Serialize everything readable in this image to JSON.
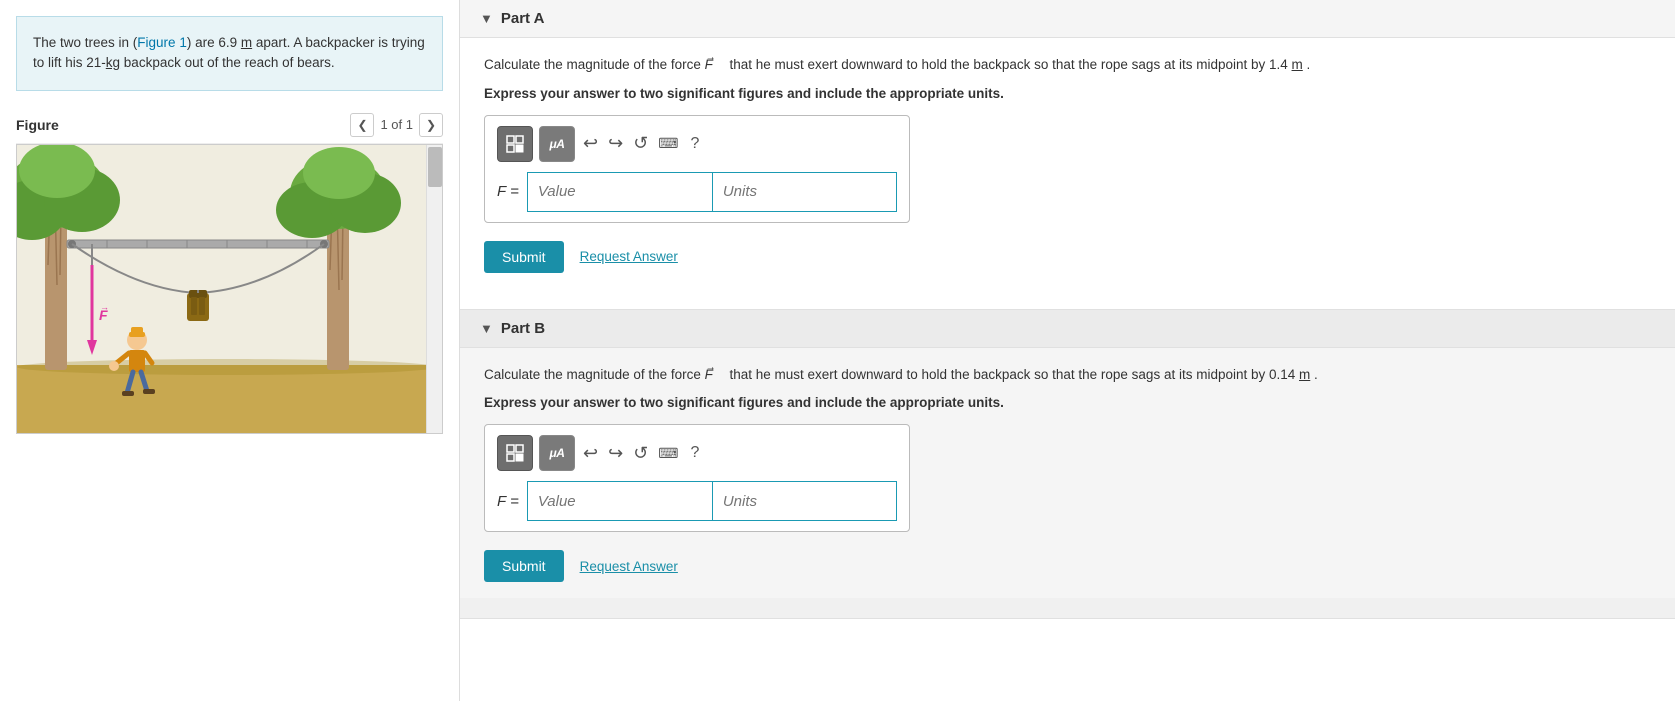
{
  "left": {
    "problem_text_before": "The two trees in (",
    "figure_link": "Figure 1",
    "problem_text_after": ") are 6.9",
    "m_unit": "m",
    "problem_text_cont": " apart. A backpacker is trying to lift his 21-",
    "kg_unit": "kg",
    "problem_text_end": " backpack out of the reach of bears.",
    "figure_title": "Figure",
    "figure_page": "1 of 1"
  },
  "right": {
    "part_a": {
      "title": "Part A",
      "question_before": "Calculate the magnitude of the force ",
      "force_var": "F",
      "question_after": " that he must exert downward to hold the backpack so that the rope sags at its midpoint by 1.4",
      "q_unit": "m",
      "express_text": "Express your answer to two significant figures and include the appropriate units.",
      "f_label": "F =",
      "value_placeholder": "Value",
      "units_placeholder": "Units",
      "submit_label": "Submit",
      "request_label": "Request Answer"
    },
    "part_b": {
      "title": "Part B",
      "question_before": "Calculate the magnitude of the force ",
      "force_var": "F",
      "question_after": " that he must exert downward to hold the backpack so that the rope sags at its midpoint by 0.14",
      "q_unit": "m",
      "express_text": "Express your answer to two significant figures and include the appropriate units.",
      "f_label": "F =",
      "value_placeholder": "Value",
      "units_placeholder": "Units",
      "submit_label": "Submit",
      "request_label": "Request Answer"
    }
  },
  "toolbar": {
    "undo_label": "↩",
    "redo_label": "↪",
    "reset_label": "↺",
    "keyboard_label": "⌨",
    "help_label": "?"
  },
  "colors": {
    "teal": "#1a8fa8",
    "light_teal_bg": "#e8f4f7",
    "toolbar_gray": "#6e6e6e"
  }
}
